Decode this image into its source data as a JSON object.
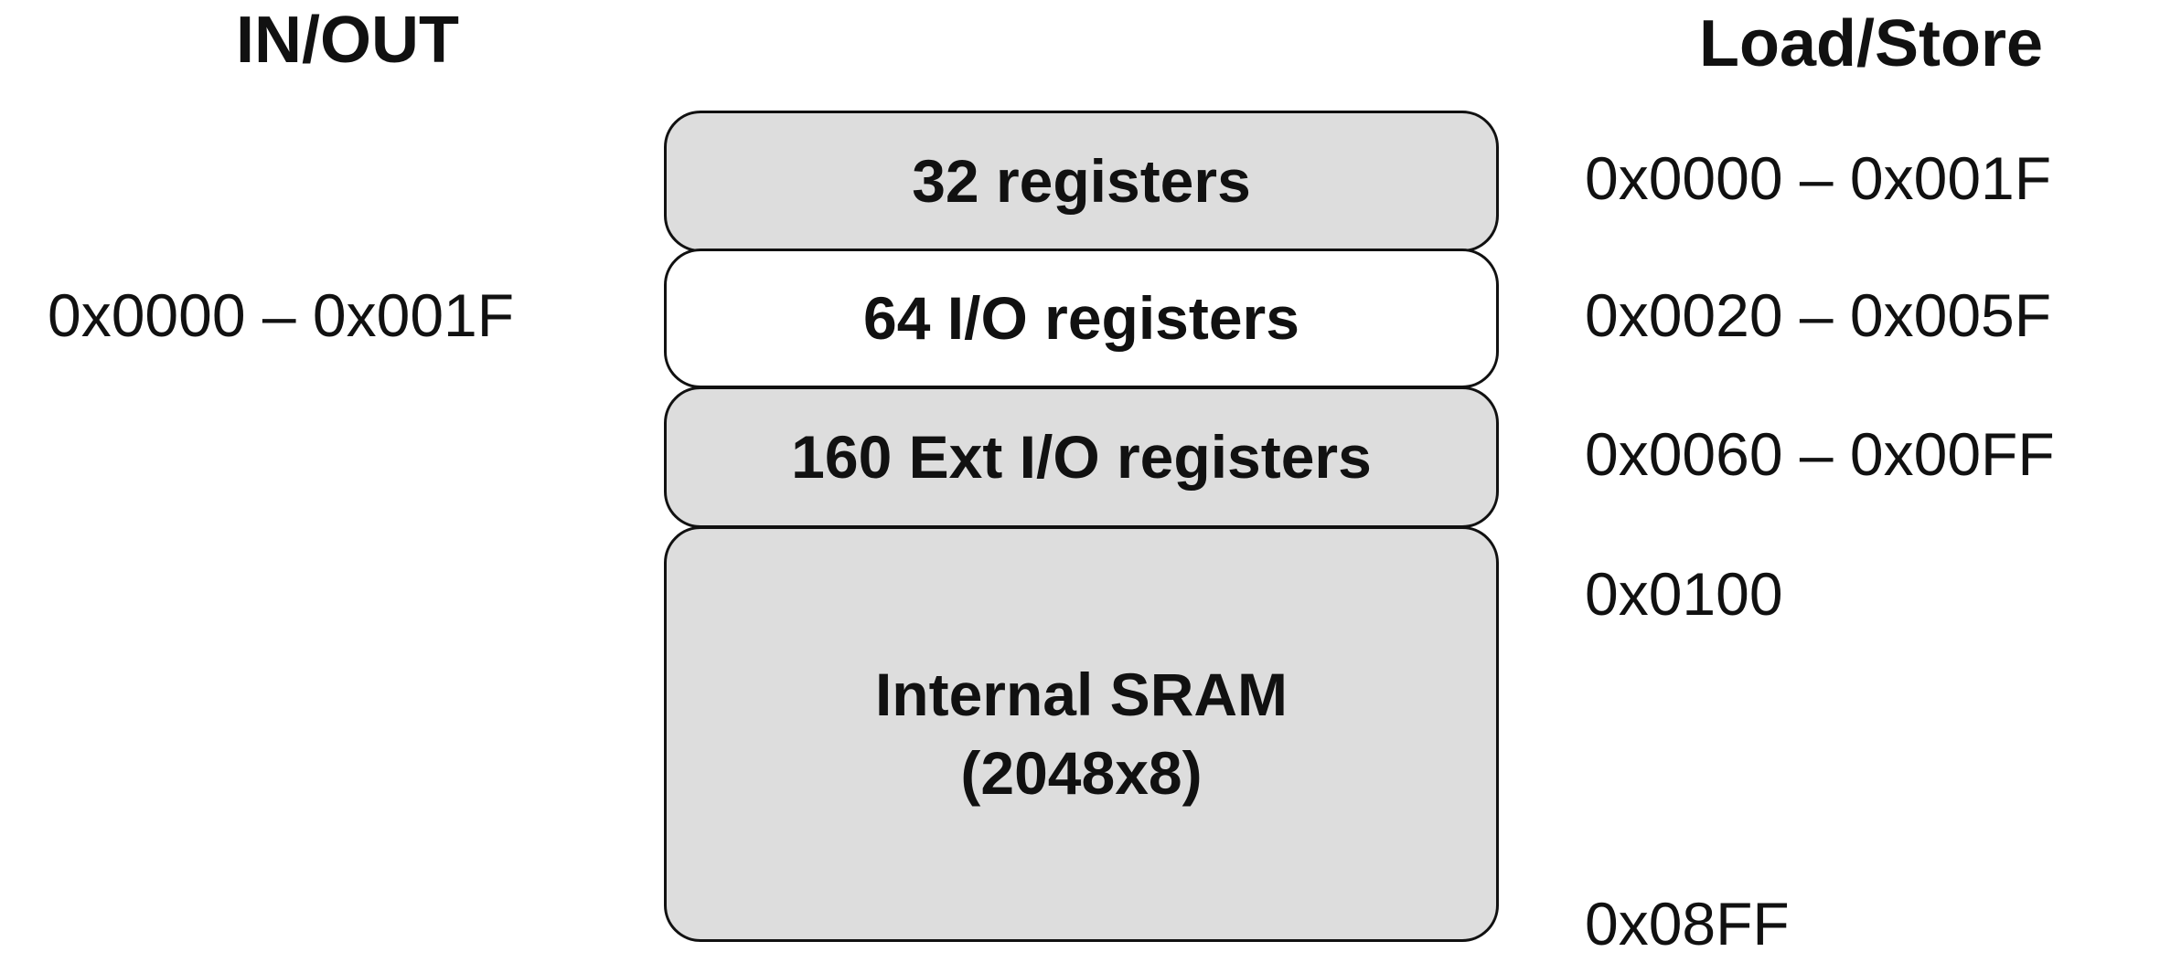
{
  "headings": {
    "in_out": "IN/OUT",
    "load_store": "Load/Store"
  },
  "blocks": [
    {
      "label": "32 registers",
      "fill": "#dddddd"
    },
    {
      "label": "64 I/O registers",
      "fill": "#ffffff"
    },
    {
      "label": "160 Ext I/O registers",
      "fill": "#dddddd"
    },
    {
      "label": "Internal SRAM",
      "sublabel": "(2048x8)",
      "fill": "#dddddd"
    }
  ],
  "in_out_addresses": [
    "0x0000 – 0x001F"
  ],
  "load_store_addresses": [
    "0x0000 – 0x001F",
    "0x0020 – 0x005F",
    "0x0060 – 0x00FF",
    "0x0100",
    "0x08FF"
  ]
}
